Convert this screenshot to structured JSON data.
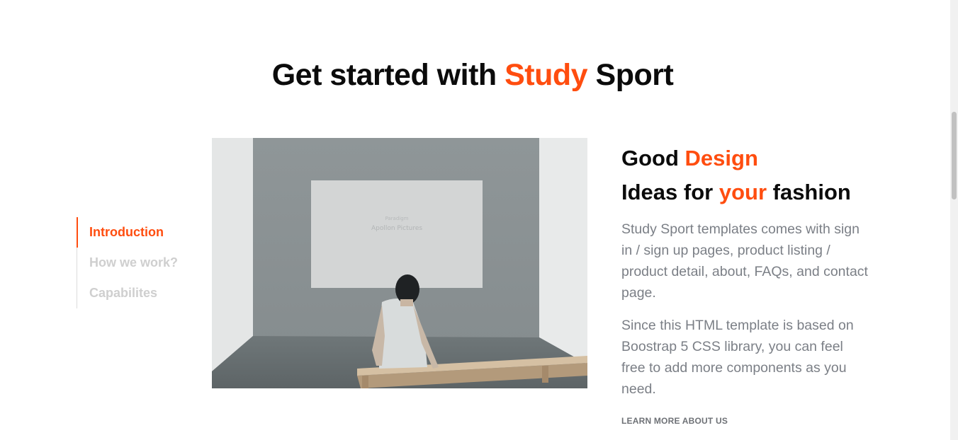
{
  "title": {
    "part1": "Get started with ",
    "accent": "Study",
    "part2": " Sport"
  },
  "tabs": [
    {
      "label": "Introduction",
      "active": true
    },
    {
      "label": "How we work?",
      "active": false
    },
    {
      "label": "Capabilites",
      "active": false
    }
  ],
  "image": {
    "screen_text_line1": "Paradigm",
    "screen_text_line2": "Apollon Pictures"
  },
  "content": {
    "heading_line1_part1": "Good ",
    "heading_line1_accent": "Design",
    "heading_line2_part1": "Ideas for ",
    "heading_line2_accent": "your",
    "heading_line2_part2": " fashion",
    "paragraph1": "Study Sport templates comes with sign in / sign up pages, product listing / product detail, about, FAQs, and contact page.",
    "paragraph2": "Since this HTML template is based on Boostrap 5 CSS library, you can feel free to add more components as you need.",
    "link_label": "LEARN MORE ABOUT US"
  },
  "colors": {
    "accent": "#ff4d0f",
    "text_dark": "#0b0b0b",
    "text_muted": "#7b7f86",
    "tab_inactive": "#cfcfcf"
  }
}
